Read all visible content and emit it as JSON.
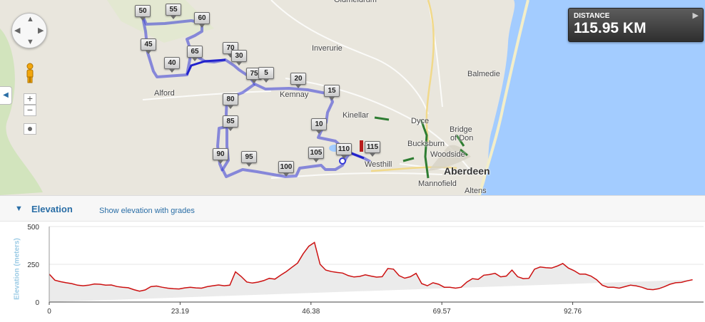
{
  "map": {
    "places": [
      {
        "name": "Inverurie",
        "cls": "",
        "key": "inverurie"
      },
      {
        "name": "Alford",
        "cls": "",
        "key": "alford"
      },
      {
        "name": "Balmedie",
        "cls": "",
        "key": "balmedie"
      },
      {
        "name": "Kemnay",
        "cls": "",
        "key": "kemnay"
      },
      {
        "name": "Kinellar",
        "cls": "",
        "key": "kinellar"
      },
      {
        "name": "Dyce",
        "cls": "",
        "key": "dyce"
      },
      {
        "name": "Bridge",
        "cls": "",
        "key": "bridge"
      },
      {
        "name": "of Don",
        "cls": "",
        "key": "ofdon"
      },
      {
        "name": "Bucksburn",
        "cls": "",
        "key": "bucksburn"
      },
      {
        "name": "Woodside",
        "cls": "",
        "key": "woodside"
      },
      {
        "name": "Aberdeen",
        "cls": "city",
        "key": "aberdeen"
      },
      {
        "name": "Mannofield",
        "cls": "",
        "key": "mannofield"
      },
      {
        "name": "Altens",
        "cls": "",
        "key": "altens"
      },
      {
        "name": "Westhill",
        "cls": "",
        "key": "westhill"
      },
      {
        "name": "Oldmeldrum",
        "cls": "",
        "key": "oldmeldrum"
      }
    ],
    "markers": [
      "50",
      "55",
      "60",
      "45",
      "65",
      "70",
      "30",
      "40",
      "75",
      "5",
      "20",
      "15",
      "80",
      "85",
      "10",
      "90",
      "95",
      "100",
      "105",
      "110",
      "115"
    ],
    "controls": {
      "pan_up": "▲",
      "pan_down": "▼",
      "pan_left": "◀",
      "pan_right": "▶",
      "zoom_in": "+",
      "zoom_out": "−",
      "collapse": "◀"
    }
  },
  "distance": {
    "label": "DISTANCE",
    "value": "115.95 KM",
    "play_icon": "▶"
  },
  "elevation": {
    "toggle_icon": "▼",
    "title": "Elevation",
    "grades_link": "Show elevation with grades"
  },
  "chart_data": {
    "type": "area",
    "ylabel": "Elevation (meters)",
    "xlabel": "",
    "ylim": [
      0,
      500
    ],
    "xlim": [
      0,
      115.95
    ],
    "yticks": [
      "0",
      "250",
      "500"
    ],
    "xticks": [
      "0",
      "23.19",
      "46.38",
      "69.57",
      "92.76"
    ],
    "xtick_values": [
      0,
      23.19,
      46.38,
      69.57,
      92.76
    ],
    "ytick_values": [
      0,
      250,
      500
    ],
    "line_color": "#cc1111",
    "fill_color": "#ebebeb",
    "x": [
      0,
      1,
      2,
      3,
      4,
      5,
      6,
      7,
      8,
      9,
      10,
      11,
      12,
      13,
      14,
      15,
      16,
      17,
      18,
      19,
      20,
      21,
      22,
      23,
      24,
      25,
      26,
      27,
      28,
      29,
      30,
      31,
      32,
      33,
      34,
      35,
      36,
      37,
      38,
      39,
      40,
      41,
      42,
      43,
      44,
      45,
      46,
      47,
      48,
      49,
      50,
      51,
      52,
      53,
      54,
      55,
      56,
      57,
      58,
      59,
      60,
      61,
      62,
      63,
      64,
      65,
      66,
      67,
      68,
      69,
      70,
      71,
      72,
      73,
      74,
      75,
      76,
      77,
      78,
      79,
      80,
      81,
      82,
      83,
      84,
      85,
      86,
      87,
      88,
      89,
      90,
      91,
      92,
      93,
      94,
      95,
      96,
      97,
      98,
      99,
      100,
      101,
      102,
      103,
      104,
      105,
      106,
      107,
      108,
      109,
      110,
      111,
      112,
      113,
      114,
      115,
      115.95
    ],
    "y": [
      185,
      145,
      135,
      128,
      122,
      112,
      108,
      112,
      120,
      118,
      112,
      113,
      103,
      98,
      95,
      82,
      72,
      80,
      102,
      106,
      98,
      92,
      88,
      87,
      94,
      98,
      94,
      92,
      102,
      108,
      113,
      108,
      112,
      200,
      170,
      133,
      126,
      132,
      142,
      157,
      152,
      178,
      202,
      230,
      258,
      320,
      370,
      395,
      250,
      212,
      202,
      196,
      192,
      175,
      166,
      170,
      180,
      172,
      165,
      168,
      222,
      218,
      175,
      158,
      168,
      190,
      122,
      108,
      128,
      118,
      98,
      98,
      92,
      98,
      132,
      155,
      150,
      178,
      182,
      190,
      167,
      172,
      212,
      168,
      155,
      157,
      218,
      232,
      228,
      225,
      238,
      255,
      225,
      208,
      185,
      185,
      172,
      148,
      112,
      98,
      98,
      92,
      102,
      112,
      107,
      98,
      85,
      82,
      88,
      102,
      118,
      128,
      130,
      140,
      148
    ]
  }
}
